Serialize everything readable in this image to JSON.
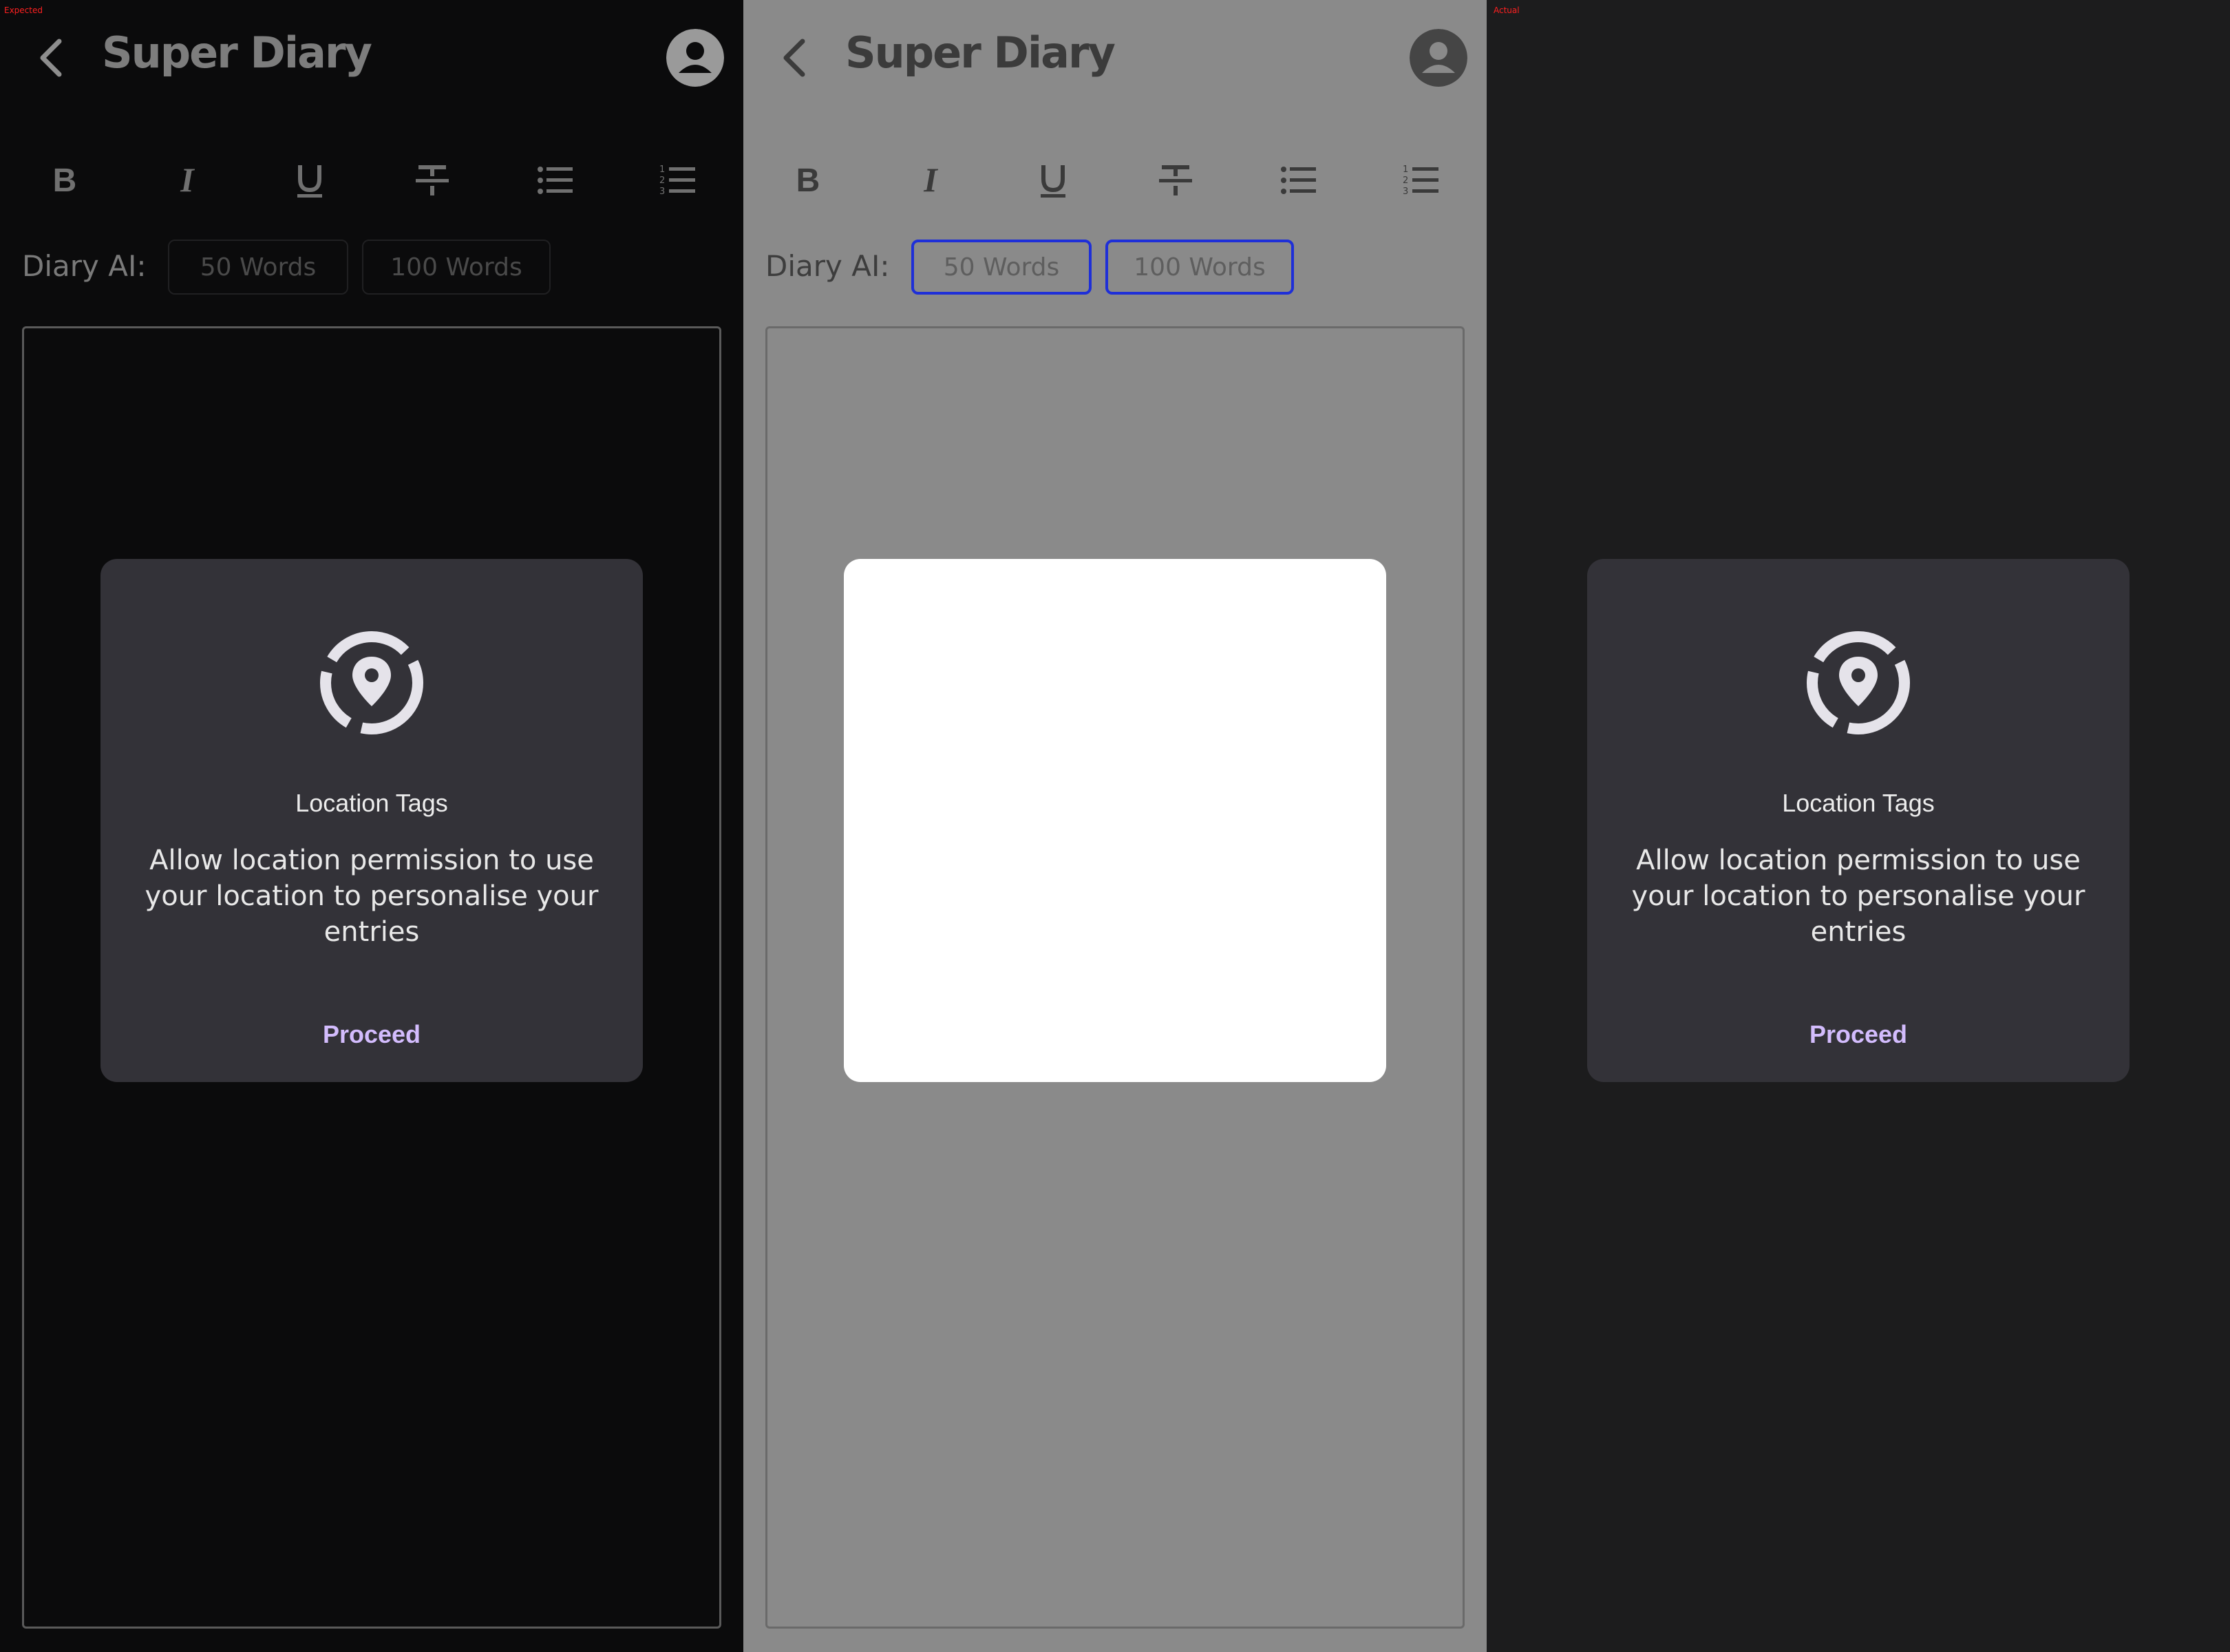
{
  "labels": {
    "expected": "Expected",
    "actual": "Actual"
  },
  "app": {
    "title": "Super Diary"
  },
  "ai": {
    "label": "Diary AI:",
    "options": [
      "50 Words",
      "100 Words"
    ]
  },
  "toolbar": [
    "bold",
    "italic",
    "underline",
    "strikethrough",
    "bulleted-list",
    "numbered-list"
  ],
  "dialog": {
    "title": "Location Tags",
    "body": "Allow location permission to use your location to personalise your entries",
    "button": "Proceed",
    "icon": "location-pin-icon"
  },
  "colors": {
    "dark_bg": "#0b0b0c",
    "dim_bg": "#8a8a8a",
    "dialog_bg": "#333238",
    "accent": "#d3bcfd",
    "focus_outline": "#1e2fd8"
  }
}
